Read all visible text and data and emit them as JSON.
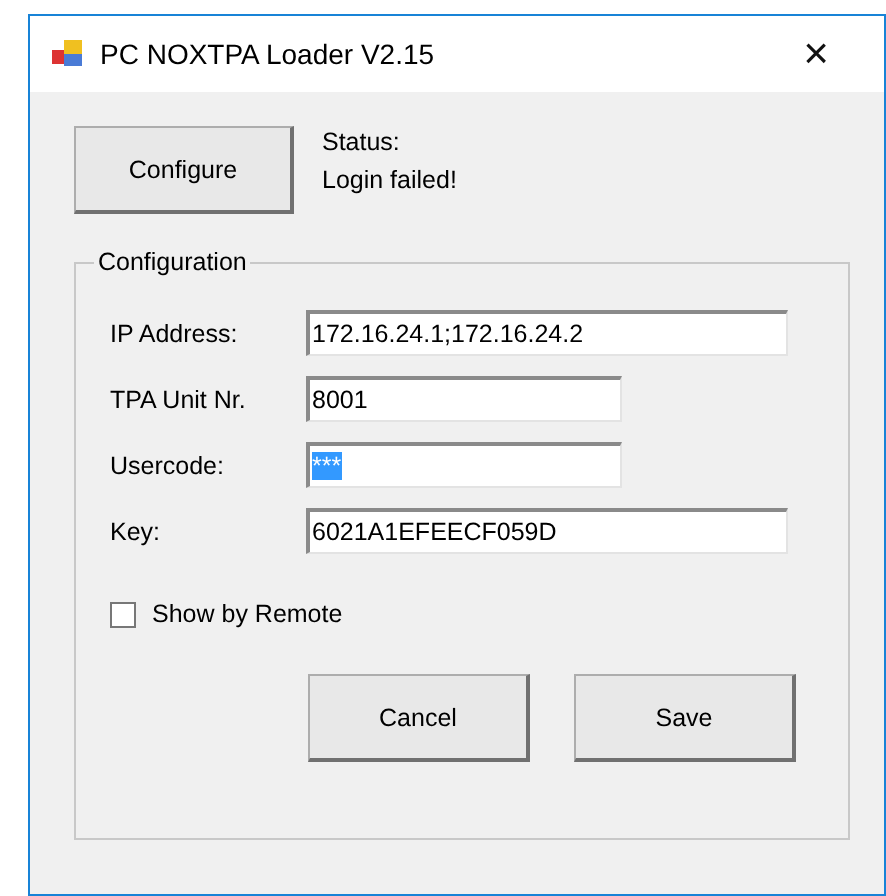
{
  "window": {
    "title": "PC NOXTPA Loader V2.15",
    "close": "×"
  },
  "configure_button": "Configure",
  "status": {
    "label": "Status:",
    "message": "Login failed!"
  },
  "configuration": {
    "title": "Configuration",
    "fields": [
      {
        "label": "IP Address:",
        "value": "172.16.24.1;172.16.24.2",
        "wide": true,
        "highlighted": false
      },
      {
        "label": "TPA Unit Nr.",
        "value": "8001",
        "wide": false,
        "highlighted": false
      },
      {
        "label": "Usercode:",
        "value": "***",
        "wide": false,
        "highlighted": true
      },
      {
        "label": "Key:",
        "value": "6021A1EFEECF059D",
        "wide": true,
        "highlighted": false
      }
    ],
    "show_by_remote": {
      "label": "Show by Remote",
      "checked": false
    },
    "buttons": [
      "Cancel",
      "Save"
    ]
  }
}
